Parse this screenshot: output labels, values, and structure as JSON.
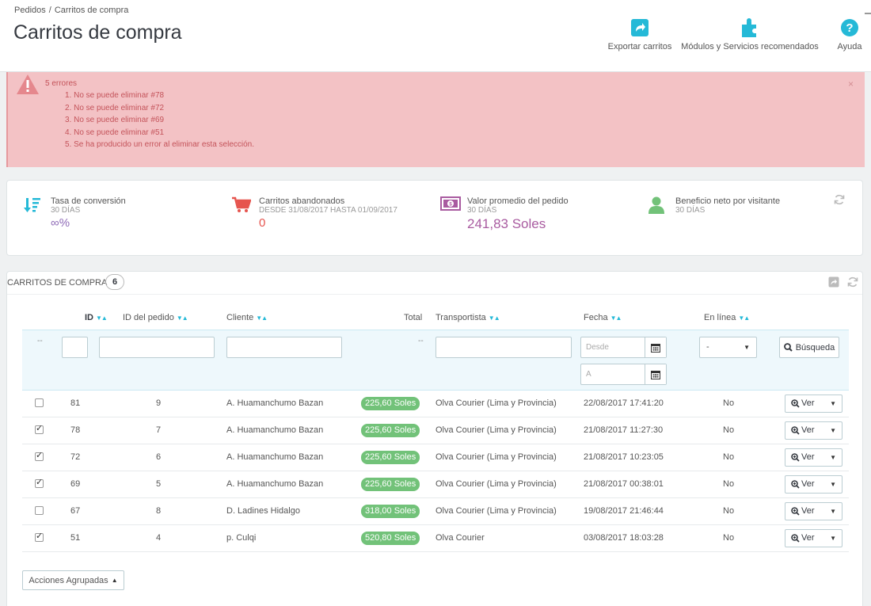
{
  "breadcrumb": {
    "parent": "Pedidos",
    "separator": "/",
    "current": "Carritos de compra"
  },
  "page_title": "Carritos de compra",
  "toolbar": {
    "export_label": "Exportar carritos",
    "modules_label": "Módulos y Servicios recomendados",
    "help_label": "Ayuda"
  },
  "alert": {
    "count_label": "5 errores",
    "errors": [
      "1. No se puede eliminar #78",
      "2. No se puede eliminar #72",
      "3. No se puede eliminar #69",
      "4. No se puede eliminar #51",
      "5. Se ha producido un error al eliminar esta selección."
    ],
    "close_label": "×"
  },
  "kpis": {
    "conversion": {
      "title": "Tasa de conversión",
      "subtitle": "30 DÍAS",
      "value": "∞%"
    },
    "abandoned": {
      "title": "Carritos abandonados",
      "subtitle": "DESDE 31/08/2017 HASTA 01/09/2017",
      "value": "0"
    },
    "avg_order": {
      "title": "Valor promedio del pedido",
      "subtitle": "30 DÍAS",
      "value": "241,83 Soles"
    },
    "net_profit": {
      "title": "Beneficio neto por visitante",
      "subtitle": "30 DÍAS",
      "value": ""
    }
  },
  "panel": {
    "title": "CARRITOS DE COMPRA",
    "count": "6"
  },
  "columns": {
    "id": "ID",
    "order_id": "ID del pedido",
    "client": "Cliente",
    "total": "Total",
    "carrier": "Transportista",
    "date": "Fecha",
    "online": "En línea"
  },
  "filters": {
    "dash": "--",
    "date_from_placeholder": "Desde",
    "date_to_placeholder": "A",
    "online_value": "-",
    "search_label": "Búsqueda"
  },
  "rows": [
    {
      "checked": false,
      "id": "81",
      "order": "9",
      "client": "A. Huamanchumo Bazan",
      "total": "225,60 Soles",
      "carrier": "Olva Courier (Lima y Provincia)",
      "date": "22/08/2017 17:41:20",
      "online": "No",
      "action": "Ver"
    },
    {
      "checked": true,
      "id": "78",
      "order": "7",
      "client": "A. Huamanchumo Bazan",
      "total": "225,60 Soles",
      "carrier": "Olva Courier (Lima y Provincia)",
      "date": "21/08/2017 11:27:30",
      "online": "No",
      "action": "Ver"
    },
    {
      "checked": true,
      "id": "72",
      "order": "6",
      "client": "A. Huamanchumo Bazan",
      "total": "225,60 Soles",
      "carrier": "Olva Courier (Lima y Provincia)",
      "date": "21/08/2017 10:23:05",
      "online": "No",
      "action": "Ver"
    },
    {
      "checked": true,
      "id": "69",
      "order": "5",
      "client": "A. Huamanchumo Bazan",
      "total": "225,60 Soles",
      "carrier": "Olva Courier (Lima y Provincia)",
      "date": "21/08/2017 00:38:01",
      "online": "No",
      "action": "Ver"
    },
    {
      "checked": false,
      "id": "67",
      "order": "8",
      "client": "D. Ladines Hidalgo",
      "total": "318,00 Soles",
      "carrier": "Olva Courier (Lima y Provincia)",
      "date": "19/08/2017 21:46:44",
      "online": "No",
      "action": "Ver"
    },
    {
      "checked": true,
      "id": "51",
      "order": "4",
      "client": "p. Culqi",
      "total": "520,80 Soles",
      "carrier": "Olva Courier",
      "date": "03/08/2017 18:03:28",
      "online": "No",
      "action": "Ver"
    }
  ],
  "bulk_actions_label": "Acciones Agrupadas",
  "colors": {
    "accent": "#25b9d7",
    "success_badge": "#72c279",
    "alert_bg": "#f3c2c5",
    "alert_text": "#c4535a",
    "kpi_value": "#b66fab"
  }
}
